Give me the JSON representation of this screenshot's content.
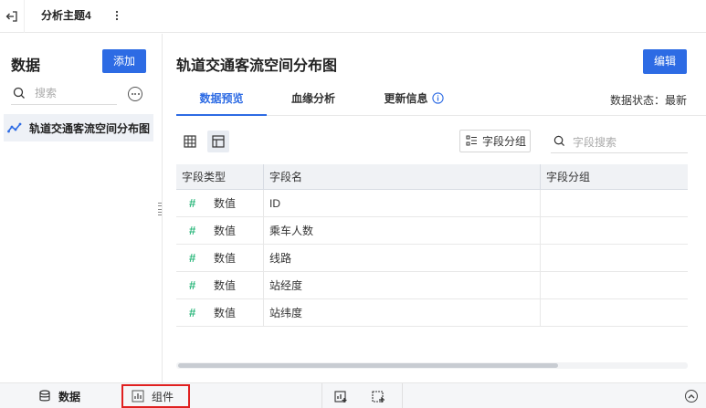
{
  "topbar": {
    "topic_tab": "分析主题4"
  },
  "left_panel": {
    "title": "数据",
    "add_button": "添加",
    "search_placeholder": "搜索",
    "items": [
      {
        "label": "轨道交通客流空间分布图",
        "icon": "line-chart-icon"
      }
    ]
  },
  "main": {
    "title": "轨道交通客流空间分布图",
    "edit_button": "编辑",
    "tabs": [
      {
        "label": "数据预览",
        "active": true
      },
      {
        "label": "血缘分析",
        "active": false
      },
      {
        "label": "更新信息",
        "active": false
      }
    ],
    "data_status": "数据状态：最新",
    "group_button": "字段分组",
    "field_search_placeholder": "字段搜索",
    "table": {
      "headers": [
        "字段类型",
        "字段名",
        "字段分组"
      ],
      "rows": [
        {
          "type": "数值",
          "name": "ID",
          "group": ""
        },
        {
          "type": "数值",
          "name": "乘车人数",
          "group": ""
        },
        {
          "type": "数值",
          "name": "线路",
          "group": ""
        },
        {
          "type": "数值",
          "name": "站经度",
          "group": ""
        },
        {
          "type": "数值",
          "name": "站纬度",
          "group": ""
        }
      ]
    }
  },
  "bottombar": {
    "data_label": "数据",
    "components_label": "组件"
  },
  "colors": {
    "accent": "#2d6be4",
    "numeric_type": "#2db87d",
    "highlight_border": "#e02020"
  }
}
